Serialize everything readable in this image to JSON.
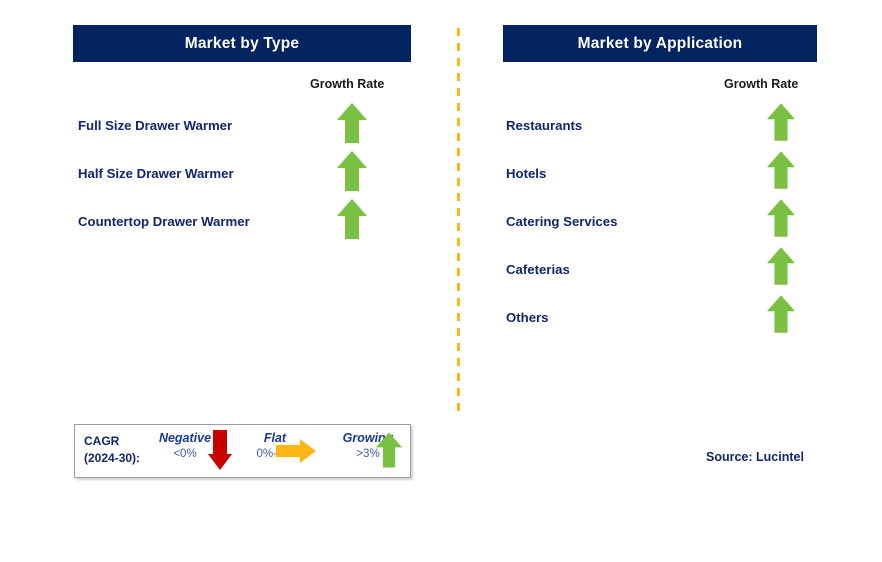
{
  "panels": [
    {
      "id": "market-by-type",
      "title": "Market by Type",
      "column_header": "Growth Rate",
      "items": [
        {
          "label": "Full Size Drawer Warmer",
          "trend": "growing",
          "icon": "arrow-up-icon"
        },
        {
          "label": "Half Size Drawer Warmer",
          "trend": "growing",
          "icon": "arrow-up-icon"
        },
        {
          "label": "Countertop Drawer Warmer",
          "trend": "growing",
          "icon": "arrow-up-icon"
        }
      ]
    },
    {
      "id": "market-by-application",
      "title": "Market by Application",
      "column_header": "Growth Rate",
      "items": [
        {
          "label": "Restaurants",
          "trend": "growing",
          "icon": "arrow-up-icon"
        },
        {
          "label": "Hotels",
          "trend": "growing",
          "icon": "arrow-up-icon"
        },
        {
          "label": "Catering Services",
          "trend": "growing",
          "icon": "arrow-up-icon"
        },
        {
          "label": "Cafeterias",
          "trend": "growing",
          "icon": "arrow-up-icon"
        },
        {
          "label": "Others",
          "trend": "growing",
          "icon": "arrow-up-icon"
        }
      ]
    }
  ],
  "legend": {
    "cagr_line1": "CAGR",
    "cagr_line2": "(2024-30):",
    "entries": [
      {
        "word": "Negative",
        "range": "<0%",
        "icon": "arrow-down-icon"
      },
      {
        "word": "Flat",
        "range": "0%-3%",
        "icon": "arrow-right-icon"
      },
      {
        "word": "Growing",
        "range": ">3%",
        "icon": "arrow-up-icon"
      }
    ]
  },
  "source": "Source: Lucintel",
  "colors": {
    "header_navy": "#032460",
    "text_navy": "#13256b",
    "growing_green": "#7ac143",
    "negative_red": "#c80000",
    "flat_orange": "#fcb614",
    "divider_orange": "#fdb813"
  }
}
